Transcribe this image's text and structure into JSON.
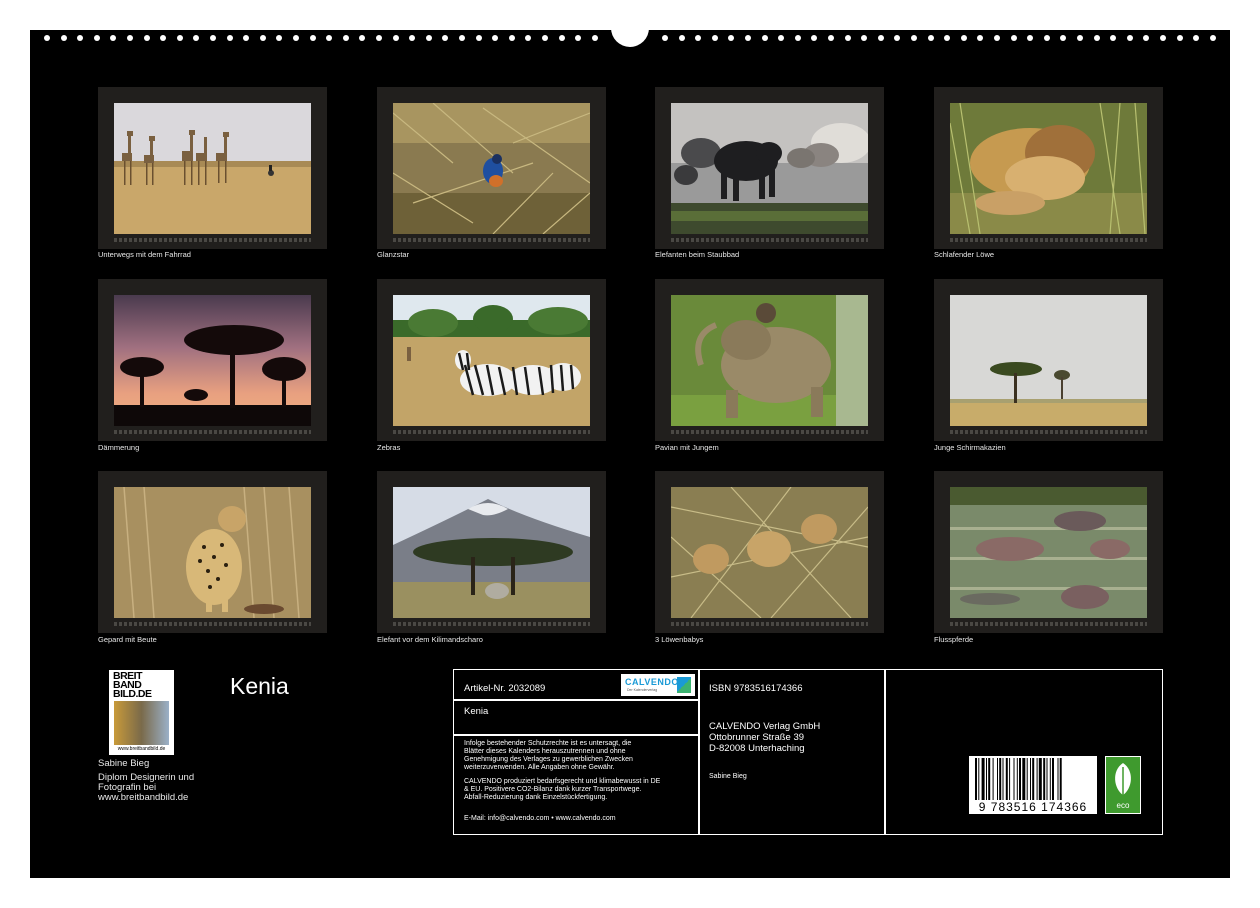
{
  "photos": [
    {
      "caption": "Unterwegs mit dem Fahrrad"
    },
    {
      "caption": "Glanzstar"
    },
    {
      "caption": "Elefanten beim Staubbad"
    },
    {
      "caption": "Schlafender Löwe"
    },
    {
      "caption": "Dämmerung"
    },
    {
      "caption": "Zebras"
    },
    {
      "caption": "Pavian mit Jungem"
    },
    {
      "caption": "Junge Schirmakazien"
    },
    {
      "caption": "Gepard mit Beute"
    },
    {
      "caption": "Elefant vor dem Kilimandscharo"
    },
    {
      "caption": "3 Löwenbabys"
    },
    {
      "caption": "Flusspferde"
    }
  ],
  "author": {
    "logo_text": "BREIT BAND BILD.DE",
    "logo_url": "www.breitbandbild.de",
    "name": "Sabine Bieg",
    "line1": "Diplom Designerin und",
    "line2": "Fotografin bei",
    "line3": "www.breitbandbild.de"
  },
  "calendar_title": "Kenia",
  "info": {
    "article": "Artikel-Nr. 2032089",
    "calvendo_logo": "CALVENDO",
    "calvendo_sub": "Der Kalenderverlag",
    "title": "Kenia",
    "legal1_l1": "Infolge bestehender Schutzrechte ist es untersagt, die",
    "legal1_l2": "Blätter dieses Kalenders herauszutrennen und ohne",
    "legal1_l3": "Genehmigung des Verlages zu gewerblichen Zwecken",
    "legal1_l4": "weiterzuverwenden. Alle Angaben ohne Gewähr.",
    "legal2_l1": "CALVENDO produziert bedarfsgerecht und klimabewusst in DE",
    "legal2_l2": "& EU. Positivere CO2-Bilanz dank kurzer Transportwege.",
    "legal2_l3": "Abfall-Reduzierung dank Einzelstückfertigung.",
    "contact": "E-Mail: info@calvendo.com • www.calvendo.com",
    "isbn": "ISBN 9783516174366",
    "publisher": "CALVENDO Verlag GmbH",
    "street": "Ottobrunner Straße 39",
    "city": "D-82008 Unterhaching",
    "author": "Sabine Bieg",
    "barcode_number": "9 783516 174366",
    "eco_label": "eco"
  }
}
